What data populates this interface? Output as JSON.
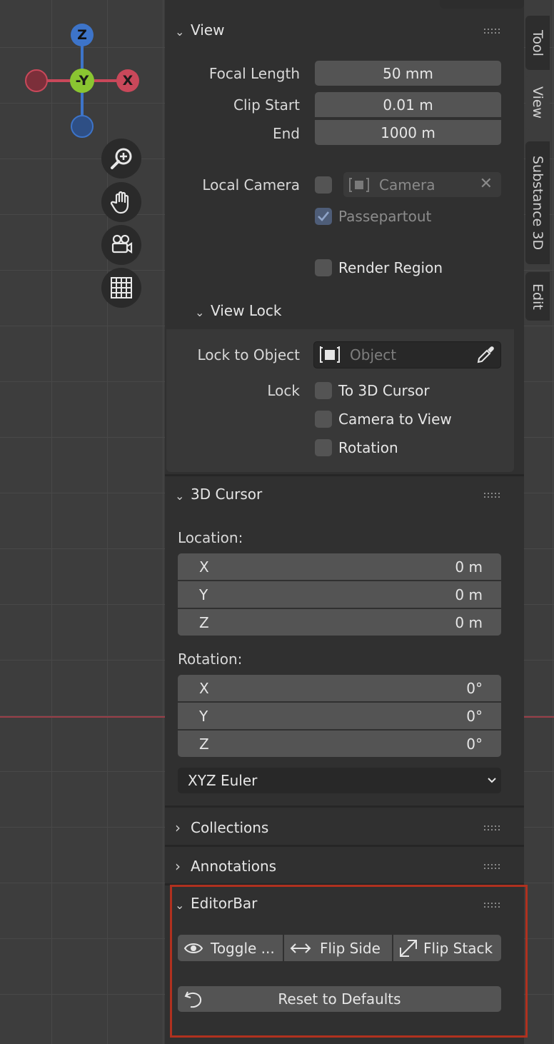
{
  "gizmo": {
    "z": "Z",
    "y": "-Y",
    "x": "X"
  },
  "tabs": [
    "Tool",
    "View",
    "Substance 3D",
    "Edit"
  ],
  "view": {
    "title": "View",
    "focal_length_label": "Focal Length",
    "focal_length": "50 mm",
    "clip_start_label": "Clip Start",
    "clip_start": "0.01 m",
    "end_label": "End",
    "end": "1000 m",
    "local_camera_label": "Local Camera",
    "camera_placeholder": "Camera",
    "passepartout": "Passepartout",
    "render_region": "Render Region"
  },
  "view_lock": {
    "title": "View Lock",
    "lock_to_object_label": "Lock to Object",
    "object_placeholder": "Object",
    "lock_label": "Lock",
    "to_3d_cursor": "To 3D Cursor",
    "camera_to_view": "Camera to View",
    "rotation": "Rotation"
  },
  "cursor": {
    "title": "3D Cursor",
    "location_label": "Location:",
    "location": [
      {
        "axis": "X",
        "value": "0 m"
      },
      {
        "axis": "Y",
        "value": "0 m"
      },
      {
        "axis": "Z",
        "value": "0 m"
      }
    ],
    "rotation_label": "Rotation:",
    "rotation": [
      {
        "axis": "X",
        "value": "0°"
      },
      {
        "axis": "Y",
        "value": "0°"
      },
      {
        "axis": "Z",
        "value": "0°"
      }
    ],
    "rotation_mode": "XYZ Euler"
  },
  "collections": {
    "title": "Collections"
  },
  "annotations": {
    "title": "Annotations"
  },
  "editorbar": {
    "title": "EditorBar",
    "toggle": "Toggle ...",
    "flip_side": "Flip Side",
    "flip_stack": "Flip Stack",
    "reset": "Reset to Defaults"
  },
  "colors": {
    "highlight_border": "#b0311f",
    "axis_x": "#c9485a",
    "axis_y": "#8ac531",
    "axis_z": "#3d74c9"
  }
}
